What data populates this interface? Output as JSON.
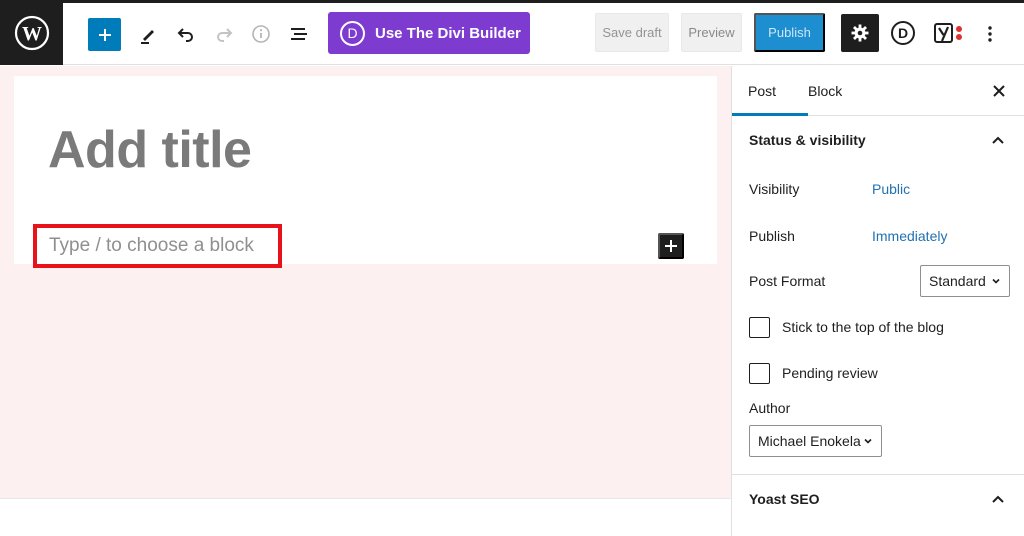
{
  "toolbar": {
    "divi_label": "Use The Divi Builder",
    "divi_logo_letter": "D",
    "save_draft": "Save draft",
    "preview": "Preview",
    "publish": "Publish",
    "divi_icon_letter": "D"
  },
  "editor": {
    "title_placeholder": "Add title",
    "block_placeholder": "Type / to choose a block"
  },
  "sidebar": {
    "tabs": [
      "Post",
      "Block"
    ],
    "status_panel": {
      "title": "Status & visibility",
      "visibility_label": "Visibility",
      "visibility_value": "Public",
      "publish_label": "Publish",
      "publish_value": "Immediately",
      "format_label": "Post Format",
      "format_value": "Standard",
      "sticky_label": "Stick to the top of the blog",
      "pending_label": "Pending review",
      "author_label": "Author",
      "author_value": "Michael Enokela"
    },
    "yoast_panel": {
      "title": "Yoast SEO"
    }
  },
  "colors": {
    "accent": "#007cba",
    "divi": "#7e3bd0",
    "link": "#2271b1",
    "highlight": "#e8121b",
    "canvas_bg": "#fdf0f0"
  }
}
